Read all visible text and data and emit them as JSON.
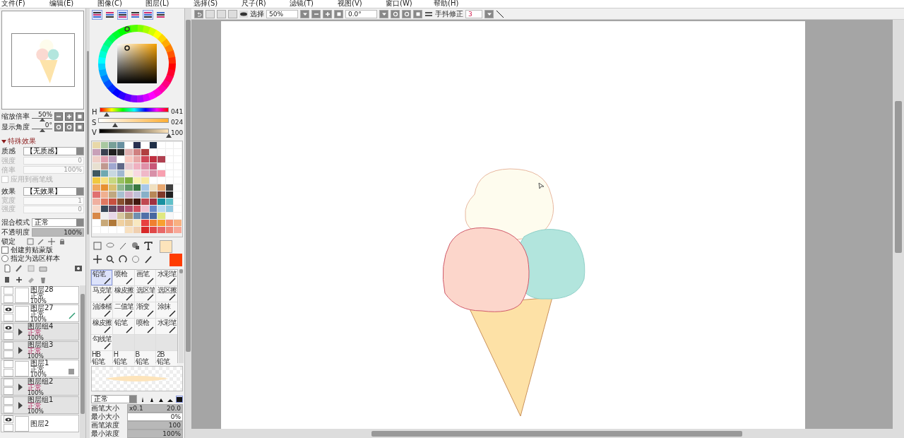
{
  "menu": [
    {
      "label": "文件(F)"
    },
    {
      "label": "编辑(E)"
    },
    {
      "label": "图像(C)"
    },
    {
      "label": "图层(L)"
    },
    {
      "label": "选择(S)"
    },
    {
      "label": "尺子(R)"
    },
    {
      "label": "滤镜(T)"
    },
    {
      "label": "视图(V)"
    },
    {
      "label": "窗口(W)"
    },
    {
      "label": "帮助(H)"
    }
  ],
  "navigator": {
    "zoom": {
      "label": "缩放倍率",
      "value": "50%",
      "level": 0.5
    },
    "angle": {
      "label": "显示角度",
      "value": "0°",
      "level": 0.5
    }
  },
  "effects": {
    "title": "特殊效果",
    "expanded": true,
    "texture": {
      "label": "质感",
      "value": "【无质感】"
    },
    "texture_params": [
      {
        "label": "强度",
        "value": "0"
      },
      {
        "label": "倍率",
        "value": "100%"
      }
    ],
    "apply_check": {
      "label": "应用到画笔线",
      "checked": false
    },
    "effect": {
      "label": "效果",
      "value": "【无效果】"
    },
    "effect_params": [
      {
        "label": "宽度",
        "value": "1"
      },
      {
        "label": "强度",
        "value": "0"
      }
    ]
  },
  "layer_props": {
    "blend": {
      "label": "混合模式",
      "value": "正常"
    },
    "opacity": {
      "label": "不透明度",
      "value": "100%",
      "level": 1
    },
    "lock_label": "锁定",
    "clip": {
      "label": "创建剪贴蒙版",
      "checked": false
    },
    "sample": {
      "label": "指定为选区样本",
      "selected": false
    }
  },
  "layers": [
    {
      "kind": "layer",
      "name": "图层28",
      "mode": "正常",
      "opacity": "100%",
      "visible": false,
      "editing": false,
      "locked": false
    },
    {
      "kind": "layer",
      "name": "图层27",
      "mode": "正常",
      "opacity": "100%",
      "visible": true,
      "editing": true,
      "locked": false
    },
    {
      "kind": "group",
      "name": "图层组4",
      "mode": "正常",
      "opacity": "100%",
      "visible": true,
      "editing": false,
      "locked": false
    },
    {
      "kind": "group",
      "name": "图层组3",
      "mode": "正常",
      "opacity": "100%",
      "visible": false,
      "editing": false,
      "locked": false
    },
    {
      "kind": "layer",
      "name": "图层1",
      "mode": "正常",
      "opacity": "100%",
      "visible": false,
      "editing": false,
      "locked": true
    },
    {
      "kind": "group",
      "name": "图层组2",
      "mode": "正常",
      "opacity": "100%",
      "visible": false,
      "editing": false,
      "locked": false
    },
    {
      "kind": "group",
      "name": "图层组1",
      "mode": "正常",
      "opacity": "100%",
      "visible": false,
      "editing": false,
      "locked": false
    },
    {
      "kind": "layer",
      "name": "图层2",
      "visible": true,
      "editing": false,
      "locked": false
    }
  ],
  "color_tabs": [
    {
      "selected": true
    },
    {
      "selected": false
    },
    {
      "selected": true
    },
    {
      "selected": false
    },
    {
      "selected": true
    },
    {
      "selected": false
    }
  ],
  "hsv": [
    {
      "label": "H",
      "value": "041",
      "level": 0.11
    },
    {
      "label": "S",
      "value": "024",
      "level": 0.24
    },
    {
      "label": "V",
      "value": "100",
      "level": 1
    }
  ],
  "swatches": [
    {
      "color": "#fde4bb"
    },
    {
      "color": "#ff3c00"
    }
  ],
  "tools": [
    {
      "name": "铅笔",
      "selected": true
    },
    {
      "name": "喷枪",
      "selected": false
    },
    {
      "name": "画笔",
      "selected": false
    },
    {
      "name": "水彩笔",
      "selected": false
    },
    {
      "name": "马克笔",
      "selected": false
    },
    {
      "name": "橡皮擦",
      "selected": false
    },
    {
      "name": "选区笔",
      "selected": false
    },
    {
      "name": "选区擦",
      "selected": false
    },
    {
      "name": "油漆桶",
      "selected": false
    },
    {
      "name": "二值笔",
      "selected": false
    },
    {
      "name": "渐变",
      "selected": false
    },
    {
      "name": "涂抹",
      "selected": false
    },
    {
      "name": "橡皮擦",
      "selected": false
    },
    {
      "name": "铅笔",
      "selected": false
    },
    {
      "name": "喷枪",
      "selected": false
    },
    {
      "name": "水彩笔",
      "selected": false
    },
    {
      "name": "勾线笔",
      "selected": false
    }
  ],
  "presets": [
    {
      "tag": "HB",
      "name": "铅笔"
    },
    {
      "tag": "H",
      "name": "铅笔"
    },
    {
      "tag": "B",
      "name": "铅笔"
    },
    {
      "tag": "2B",
      "name": "铅笔"
    }
  ],
  "brush": {
    "mode": "正常",
    "shapes": [
      {
        "selected": false
      },
      {
        "selected": false
      },
      {
        "selected": false
      },
      {
        "selected": false
      },
      {
        "selected": true
      }
    ],
    "params": [
      {
        "label": "画笔大小",
        "prefix": "x0.1",
        "value": "20.0",
        "level": 1
      },
      {
        "label": "最小大小",
        "value": "0%",
        "level": 0
      },
      {
        "label": "画笔浓度",
        "value": "100",
        "level": 1
      },
      {
        "label": "最小浓度",
        "value": "100%",
        "level": 1
      }
    ]
  },
  "toolbar": {
    "select_label": "选择",
    "zoom": "50%",
    "angle": "0.0°",
    "stabilizer_label": "手抖修正",
    "stabilizer": "3"
  }
}
